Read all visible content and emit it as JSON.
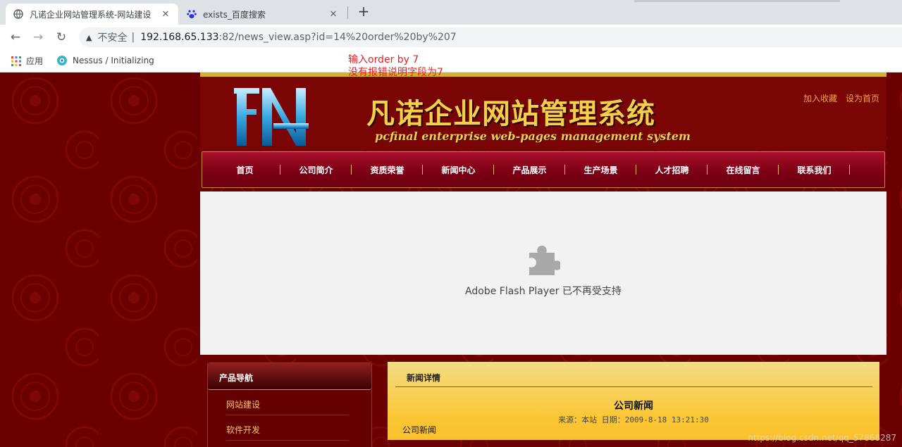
{
  "browser": {
    "tabs": [
      {
        "title": "凡诺企业网站管理系统-网站建设",
        "close": "✕",
        "icon": "globe-icon"
      },
      {
        "title": "exists_百度搜索",
        "close": "✕",
        "icon": "baidu-paw-icon"
      }
    ],
    "new_tab": "+",
    "nav": {
      "back": "←",
      "forward": "→",
      "reload": "↻"
    },
    "address": {
      "warning": "▲",
      "insecure": "不安全",
      "separator": "|",
      "host": "192.168.65.133",
      "path": ":82/news_view.asp?id=14%20order%20by%207"
    },
    "bookmarks": [
      {
        "label": "应用",
        "icon": "apps-grid-icon"
      },
      {
        "label": "Nessus / Initializing",
        "icon": "nessus-icon"
      }
    ]
  },
  "annotation": {
    "line1": "输入order by 7",
    "line2": "没有报错说明字段为7"
  },
  "site": {
    "title_cn": "凡诺企业网站管理系统",
    "title_en": "pcfinal enterprise web-pages management system",
    "top_links": [
      "加入收藏",
      "设为首页"
    ],
    "menu": [
      "首页",
      "公司简介",
      "资质荣誉",
      "新闻中心",
      "产品展示",
      "生产场景",
      "人才招聘",
      "在线留言",
      "联系我们"
    ],
    "flash_message": "Adobe Flash Player 已不再受支持",
    "sidebar": {
      "title": "产品导航",
      "items": [
        "网站建设",
        "软件开发"
      ]
    },
    "news": {
      "section_title": "新闻详情",
      "title": "公司新闻",
      "meta": "来源：本站  日期：2009-8-18 13:21:30",
      "body": "公司新闻"
    }
  },
  "watermark": "https://blog.csdn.net/qq_57868287",
  "colors": {
    "page_bg": "#6b0000",
    "gold": "#f4cf4a",
    "annotation": "#e52222",
    "menu_bg": "#7d0015"
  }
}
